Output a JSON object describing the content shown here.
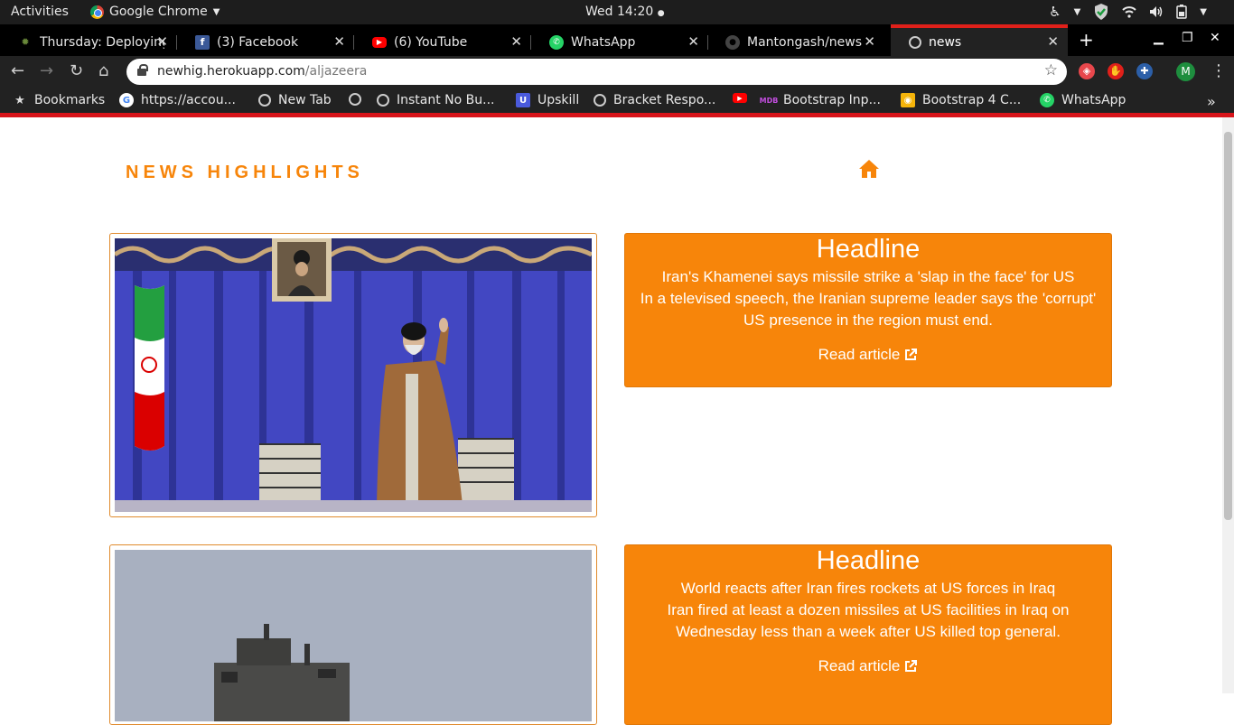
{
  "system_bar": {
    "activities": "Activities",
    "app_name": "Google Chrome",
    "clock": "Wed 14:20"
  },
  "tabs": [
    {
      "title": "Thursday: Deploying",
      "icon": "deploy-icon"
    },
    {
      "title": "(3) Facebook",
      "icon": "facebook-icon"
    },
    {
      "title": "(6) YouTube",
      "icon": "youtube-icon"
    },
    {
      "title": "WhatsApp",
      "icon": "whatsapp-icon"
    },
    {
      "title": "Mantongash/news",
      "icon": "github-icon"
    },
    {
      "title": "news",
      "icon": "globe-icon"
    }
  ],
  "address_bar": {
    "host": "newhig.herokuapp.com",
    "path": "/aljazeera"
  },
  "bookmarks": [
    {
      "label": "Bookmarks",
      "icon": "star-icon"
    },
    {
      "label": "https://accou...",
      "icon": "google-icon"
    },
    {
      "label": "New Tab",
      "icon": "globe-icon"
    },
    {
      "label": "Instant No Bu...",
      "icon": "globe-icon"
    },
    {
      "label": "Upskill",
      "icon": "upskill-icon"
    },
    {
      "label": "Bracket Respo...",
      "icon": "globe-icon"
    },
    {
      "label": "Bootstrap Inp...",
      "icon": "mdb-icon"
    },
    {
      "label": "Bootstrap 4 C...",
      "icon": "bootstrap-icon"
    },
    {
      "label": "WhatsApp",
      "icon": "whatsapp-icon"
    }
  ],
  "page": {
    "brand": "NEWS HIGHLIGHTS",
    "articles": [
      {
        "heading": "Headline",
        "title": "Iran's Khamenei says missile strike a 'slap in the face' for US",
        "description": "In a televised speech, the Iranian supreme leader says the 'corrupt' US presence in the region must end.",
        "link": "Read article"
      },
      {
        "heading": "Headline",
        "title": "World reacts after Iran fires rockets at US forces in Iraq",
        "description": "Iran fired at least a dozen missiles at US facilities in Iraq on Wednesday less than a week after US killed top general.",
        "link": "Read article"
      }
    ]
  },
  "colors": {
    "accent": "#f7850a",
    "chrome_dark": "#222222",
    "active_tab_bar": "#e0201a"
  }
}
